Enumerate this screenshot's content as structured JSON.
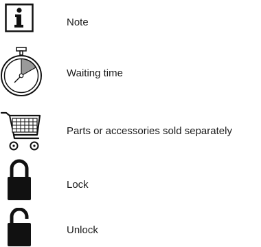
{
  "legend": {
    "items": [
      {
        "icon": "info-icon",
        "label": "Note"
      },
      {
        "icon": "stopwatch-icon",
        "label": "Waiting time"
      },
      {
        "icon": "shopping-cart-icon",
        "label": "Parts or accessories sold separately"
      },
      {
        "icon": "lock-icon",
        "label": "Lock"
      },
      {
        "icon": "unlock-icon",
        "label": "Unlock"
      }
    ]
  }
}
